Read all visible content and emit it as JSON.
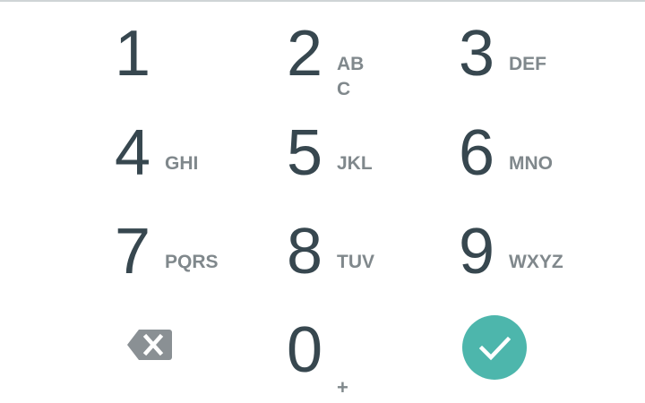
{
  "keypad": {
    "keys": [
      {
        "digit": "1",
        "letters": ""
      },
      {
        "digit": "2",
        "letters": "ABC"
      },
      {
        "digit": "3",
        "letters": "DEF"
      },
      {
        "digit": "4",
        "letters": "GHI"
      },
      {
        "digit": "5",
        "letters": "JKL"
      },
      {
        "digit": "6",
        "letters": "MNO"
      },
      {
        "digit": "7",
        "letters": "PQRS"
      },
      {
        "digit": "8",
        "letters": "TUV"
      },
      {
        "digit": "9",
        "letters": "WXYZ"
      },
      {
        "digit": "0",
        "letters": "+"
      }
    ],
    "backspace_icon": "backspace-icon",
    "confirm_icon": "checkmark-icon"
  },
  "colors": {
    "digit": "#37474f",
    "letters": "#80888c",
    "backspace": "#8a9094",
    "confirm": "#4db6ac",
    "divider": "#cfd4d6"
  }
}
